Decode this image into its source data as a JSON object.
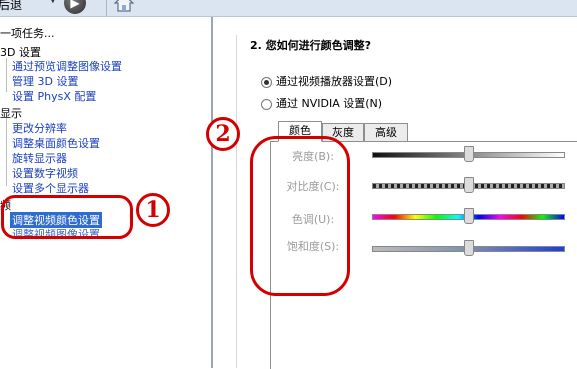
{
  "toolbar": {
    "back_label": "后退",
    "caret": "▼",
    "forward_glyph": "▶"
  },
  "tree": {
    "task_header": "一项任务...",
    "groups": [
      {
        "title": "3D 设置",
        "items": [
          "通过预览调整图像设置",
          "管理 3D 设置",
          "设置 PhysX 配置"
        ]
      },
      {
        "title": "显示",
        "items": [
          "更改分辨率",
          "调整桌面颜色设置",
          "旋转显示器",
          "设置数字视频",
          "设置多个显示器"
        ]
      },
      {
        "title": "频",
        "items": [
          "调整视频颜色设置",
          "调整视频图像设置"
        ]
      }
    ],
    "selected": "调整视频颜色设置"
  },
  "panel": {
    "section_title": "2. 您如何进行颜色调整?",
    "options": [
      {
        "label": "通过视频播放器设置(D)",
        "checked": true
      },
      {
        "label": "通过 NVIDIA 设置(N)",
        "checked": false
      }
    ],
    "tabs": [
      "颜色",
      "灰度",
      "高级"
    ],
    "active_tab": "颜色",
    "sliders": [
      {
        "label": "亮度(B):",
        "level": 0.5
      },
      {
        "label": "对比度(C):",
        "level": 0.5
      },
      {
        "label": "色调(U):",
        "level": 0.5
      },
      {
        "label": "饱和度(S):",
        "level": 0.5
      }
    ]
  },
  "annotations": {
    "marker_1": "1",
    "marker_2": "2",
    "color": "#d40000"
  }
}
